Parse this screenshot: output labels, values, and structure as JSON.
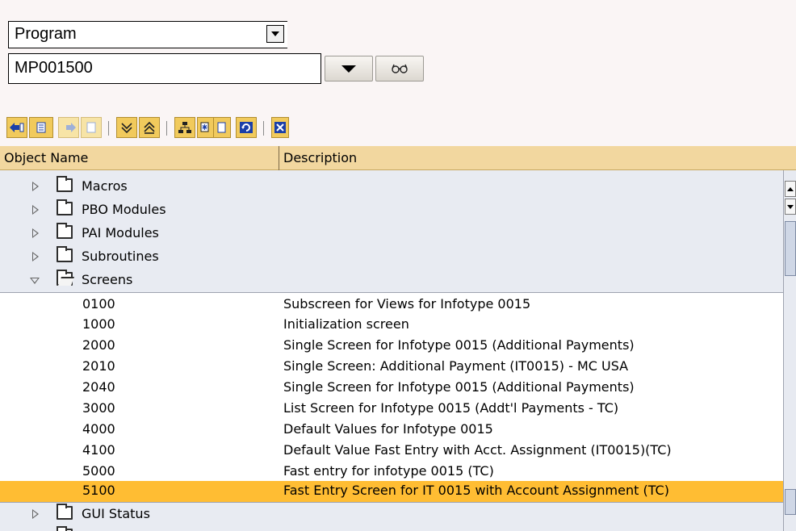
{
  "selection": {
    "object_type": "Program",
    "object_name": "MP001500"
  },
  "toolbar": {
    "buttons": [
      {
        "name": "back-arrow-icon"
      },
      {
        "name": "forward-arrow-icon"
      },
      {
        "name": "expand-all-icon"
      },
      {
        "name": "collapse-all-icon"
      },
      {
        "name": "hierarchy-icon"
      },
      {
        "name": "select-icon"
      },
      {
        "name": "refresh-icon"
      },
      {
        "name": "close-window-icon"
      }
    ]
  },
  "table": {
    "columns": [
      "Object Name",
      "Description"
    ],
    "rows": [
      {
        "name": "Macros",
        "desc": "",
        "type": "folder",
        "expanded": false
      },
      {
        "name": "PBO Modules",
        "desc": "",
        "type": "folder",
        "expanded": false
      },
      {
        "name": "PAI Modules",
        "desc": "",
        "type": "folder",
        "expanded": false
      },
      {
        "name": "Subroutines",
        "desc": "",
        "type": "folder",
        "expanded": false
      },
      {
        "name": "Screens",
        "desc": "",
        "type": "folder",
        "expanded": true
      },
      {
        "name": "0100",
        "desc": "Subscreen for Views for Infotype 0015",
        "type": "screen"
      },
      {
        "name": "1000",
        "desc": "Initialization screen",
        "type": "screen"
      },
      {
        "name": "2000",
        "desc": "Single Screen for Infotype 0015 (Additional Payments)",
        "type": "screen"
      },
      {
        "name": "2010",
        "desc": "Single Screen: Additional Payment (IT0015) - MC USA",
        "type": "screen"
      },
      {
        "name": "2040",
        "desc": "Single Screen for Infotype 0015 (Additional Payments)",
        "type": "screen"
      },
      {
        "name": "3000",
        "desc": "List Screen for Infotype 0015 (Addt'l Payments - TC)",
        "type": "screen"
      },
      {
        "name": "4000",
        "desc": "Default Values for Infotype 0015",
        "type": "screen"
      },
      {
        "name": "4100",
        "desc": "Default Value Fast Entry with Acct. Assignment (IT0015)(TC)",
        "type": "screen"
      },
      {
        "name": "5000",
        "desc": "Fast entry for infotype 0015 (TC)",
        "type": "screen"
      },
      {
        "name": "5100",
        "desc": "Fast Entry Screen for IT 0015 with Account Assignment (TC)",
        "type": "screen",
        "selected": true
      },
      {
        "name": "GUI Status",
        "desc": "",
        "type": "folder",
        "expanded": false
      }
    ]
  },
  "colors": {
    "toolbar_button": "#f1ca5c",
    "header": "#f2d79f",
    "selected_row": "#ffbd33",
    "grid_background": "#e8ebf2"
  }
}
